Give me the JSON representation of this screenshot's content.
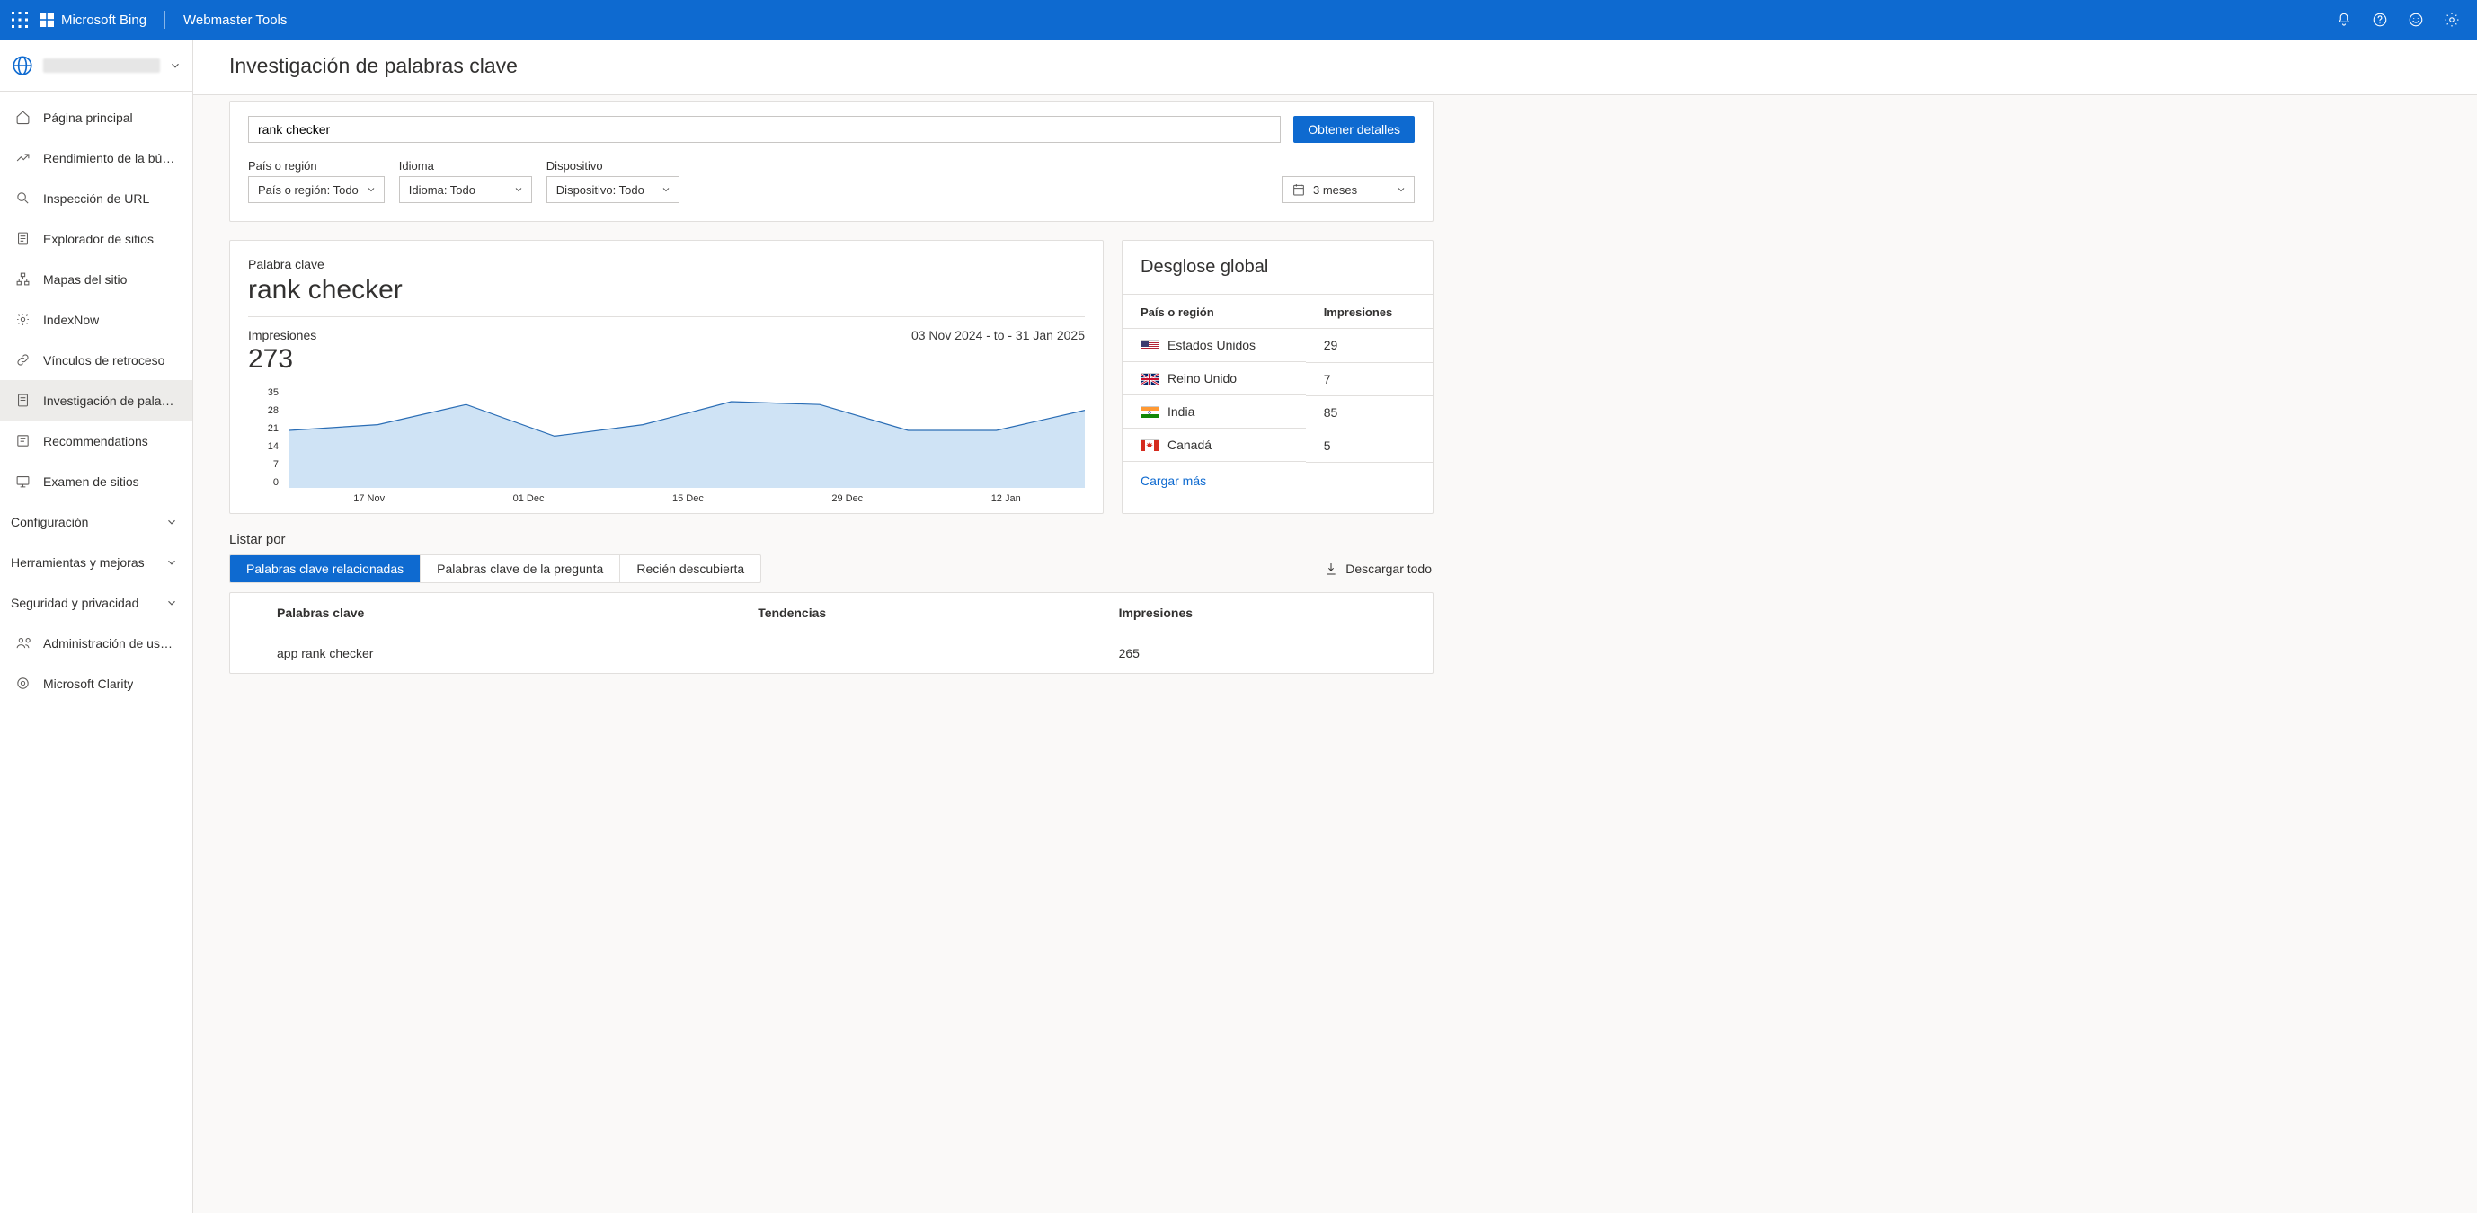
{
  "header": {
    "brand1": "Microsoft Bing",
    "brand2": "Webmaster Tools"
  },
  "sidebar": {
    "items": [
      {
        "label": "Página principal"
      },
      {
        "label": "Rendimiento de la búsque…"
      },
      {
        "label": "Inspección de URL"
      },
      {
        "label": "Explorador de sitios"
      },
      {
        "label": "Mapas del sitio"
      },
      {
        "label": "IndexNow"
      },
      {
        "label": "Vínculos de retroceso"
      },
      {
        "label": "Investigación de palabras …"
      },
      {
        "label": "Recommendations"
      },
      {
        "label": "Examen de sitios"
      }
    ],
    "sections": [
      {
        "label": "Configuración"
      },
      {
        "label": "Herramientas y mejoras"
      },
      {
        "label": "Seguridad y privacidad"
      }
    ],
    "bottom": [
      {
        "label": "Administración de usuarios"
      },
      {
        "label": "Microsoft Clarity"
      }
    ]
  },
  "page": {
    "title": "Investigación de palabras clave"
  },
  "search": {
    "value": "rank checker",
    "button": "Obtener detalles",
    "country_label": "País o región",
    "country_value": "País o región: Todo",
    "lang_label": "Idioma",
    "lang_value": "Idioma: Todo",
    "device_label": "Dispositivo",
    "device_value": "Dispositivo: Todo",
    "period": "3 meses"
  },
  "kwcard": {
    "label": "Palabra clave",
    "title": "rank checker",
    "impr_label": "Impresiones",
    "impr_value": "273",
    "date_range": "03 Nov 2024 - to - 31 Jan 2025"
  },
  "chart_data": {
    "type": "area",
    "x": [
      "17 Nov",
      "01 Dec",
      "15 Dec",
      "29 Dec",
      "12 Jan"
    ],
    "values": [
      20,
      22,
      29,
      18,
      22,
      30,
      29,
      20,
      20,
      27
    ],
    "ylim": [
      0,
      35
    ],
    "yticks": [
      35,
      28,
      21,
      14,
      7,
      0
    ],
    "ylabel": "",
    "xlabel": "",
    "title": ""
  },
  "global": {
    "title": "Desglose global",
    "country_hdr": "País o región",
    "impr_hdr": "Impresiones",
    "rows": [
      {
        "country": "Estados Unidos",
        "impr": "29",
        "flag": "us"
      },
      {
        "country": "Reino Unido",
        "impr": "7",
        "flag": "gb"
      },
      {
        "country": "India",
        "impr": "85",
        "flag": "in"
      },
      {
        "country": "Canadá",
        "impr": "5",
        "flag": "ca"
      }
    ],
    "load_more": "Cargar más"
  },
  "list": {
    "label": "Listar por",
    "tab1": "Palabras clave relacionadas",
    "tab2": "Palabras clave de la pregunta",
    "tab3": "Recién descubierta",
    "download": "Descargar todo",
    "col_kw": "Palabras clave",
    "col_trend": "Tendencias",
    "col_impr": "Impresiones",
    "rows": [
      {
        "kw": "app rank checker",
        "impr": "265"
      }
    ]
  }
}
